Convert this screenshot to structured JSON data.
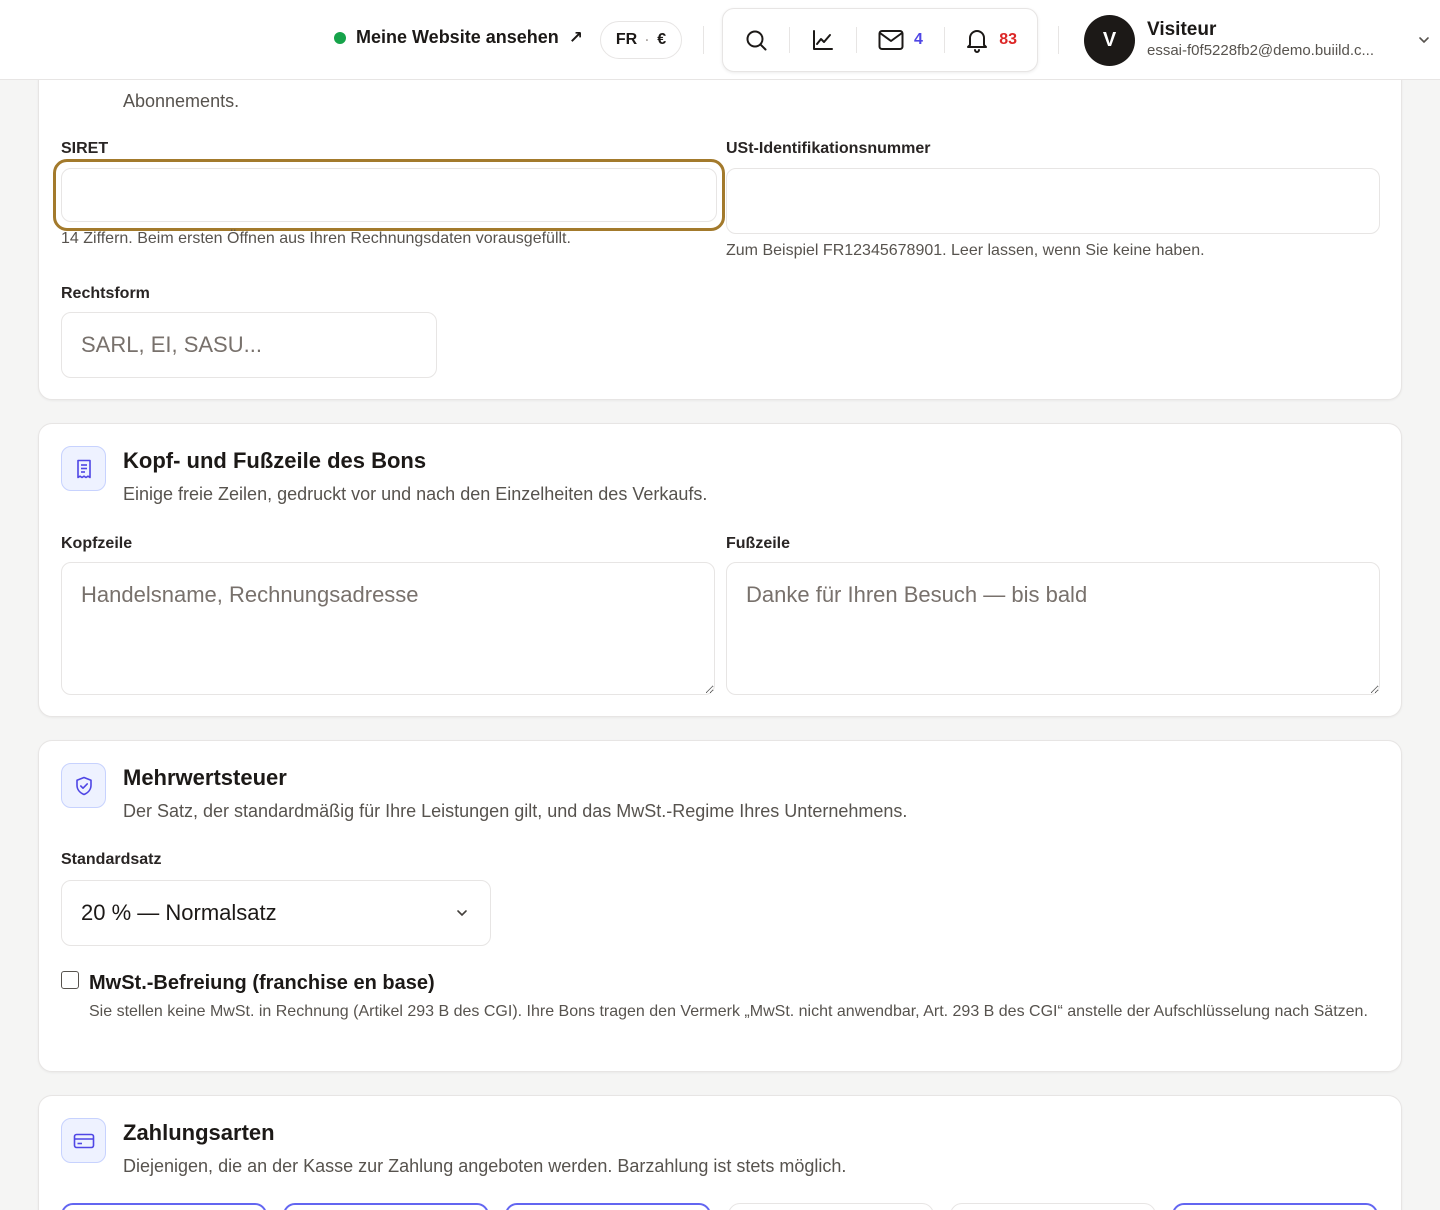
{
  "header": {
    "site_link": "Meine Website ansehen",
    "site_link_arrow": "↗",
    "lang": "FR",
    "currency": "€",
    "messages_count": "4",
    "notifications_count": "83",
    "avatar_letter": "V",
    "user_name": "Visiteur",
    "user_email": "essai-f0f5228fb2@demo.buiild.c..."
  },
  "company": {
    "cut_text": "Abonnements.",
    "siret_label": "SIRET",
    "siret_value": "",
    "siret_hint": "14 Ziffern. Beim ersten Öffnen aus Ihren Rechnungsdaten vorausgefüllt.",
    "vat_id_label": "USt-Identifikationsnummer",
    "vat_id_value": "",
    "vat_id_hint": "Zum Beispiel FR12345678901. Leer lassen, wenn Sie keine haben.",
    "legal_form_label": "Rechtsform",
    "legal_form_placeholder": "SARL, EI, SASU..."
  },
  "receipt": {
    "title": "Kopf- und Fußzeile des Bons",
    "subtitle": "Einige freie Zeilen, gedruckt vor und nach den Einzelheiten des Verkaufs.",
    "header_label": "Kopfzeile",
    "header_placeholder": "Handelsname, Rechnungsadresse",
    "footer_label": "Fußzeile",
    "footer_placeholder": "Danke für Ihren Besuch — bis bald"
  },
  "vat": {
    "title": "Mehrwertsteuer",
    "subtitle": "Der Satz, der standardmäßig für Ihre Leistungen gilt, und das MwSt.-Regime Ihres Unternehmens.",
    "rate_label": "Standardsatz",
    "rate_value": "20 % — Normalsatz",
    "exemption_label": "MwSt.-Befreiung (franchise en base)",
    "exemption_checked": false,
    "exemption_desc": "Sie stellen keine MwSt. in Rechnung (Artikel 293 B des CGI). Ihre Bons tragen den Vermerk „MwSt. nicht anwendbar, Art. 293 B des CGI“ anstelle der Aufschlüsselung nach Sätzen."
  },
  "payment": {
    "title": "Zahlungsarten",
    "subtitle": "Diejenigen, die an der Kasse zur Zahlung angeboten werden. Barzahlung ist stets möglich.",
    "chips_active": [
      true,
      true,
      true,
      false,
      false,
      true
    ]
  },
  "colors": {
    "accent": "#6366f1",
    "focus_ring": "#a37a2c",
    "online_dot": "#16a34a",
    "messages": "#4f46e5",
    "notifications": "#dc2626"
  },
  "icons": [
    "external-arrow-icon",
    "search-icon",
    "chart-icon",
    "mail-icon",
    "bell-icon",
    "chevron-down-icon",
    "receipt-icon",
    "shield-check-icon",
    "credit-card-icon"
  ]
}
